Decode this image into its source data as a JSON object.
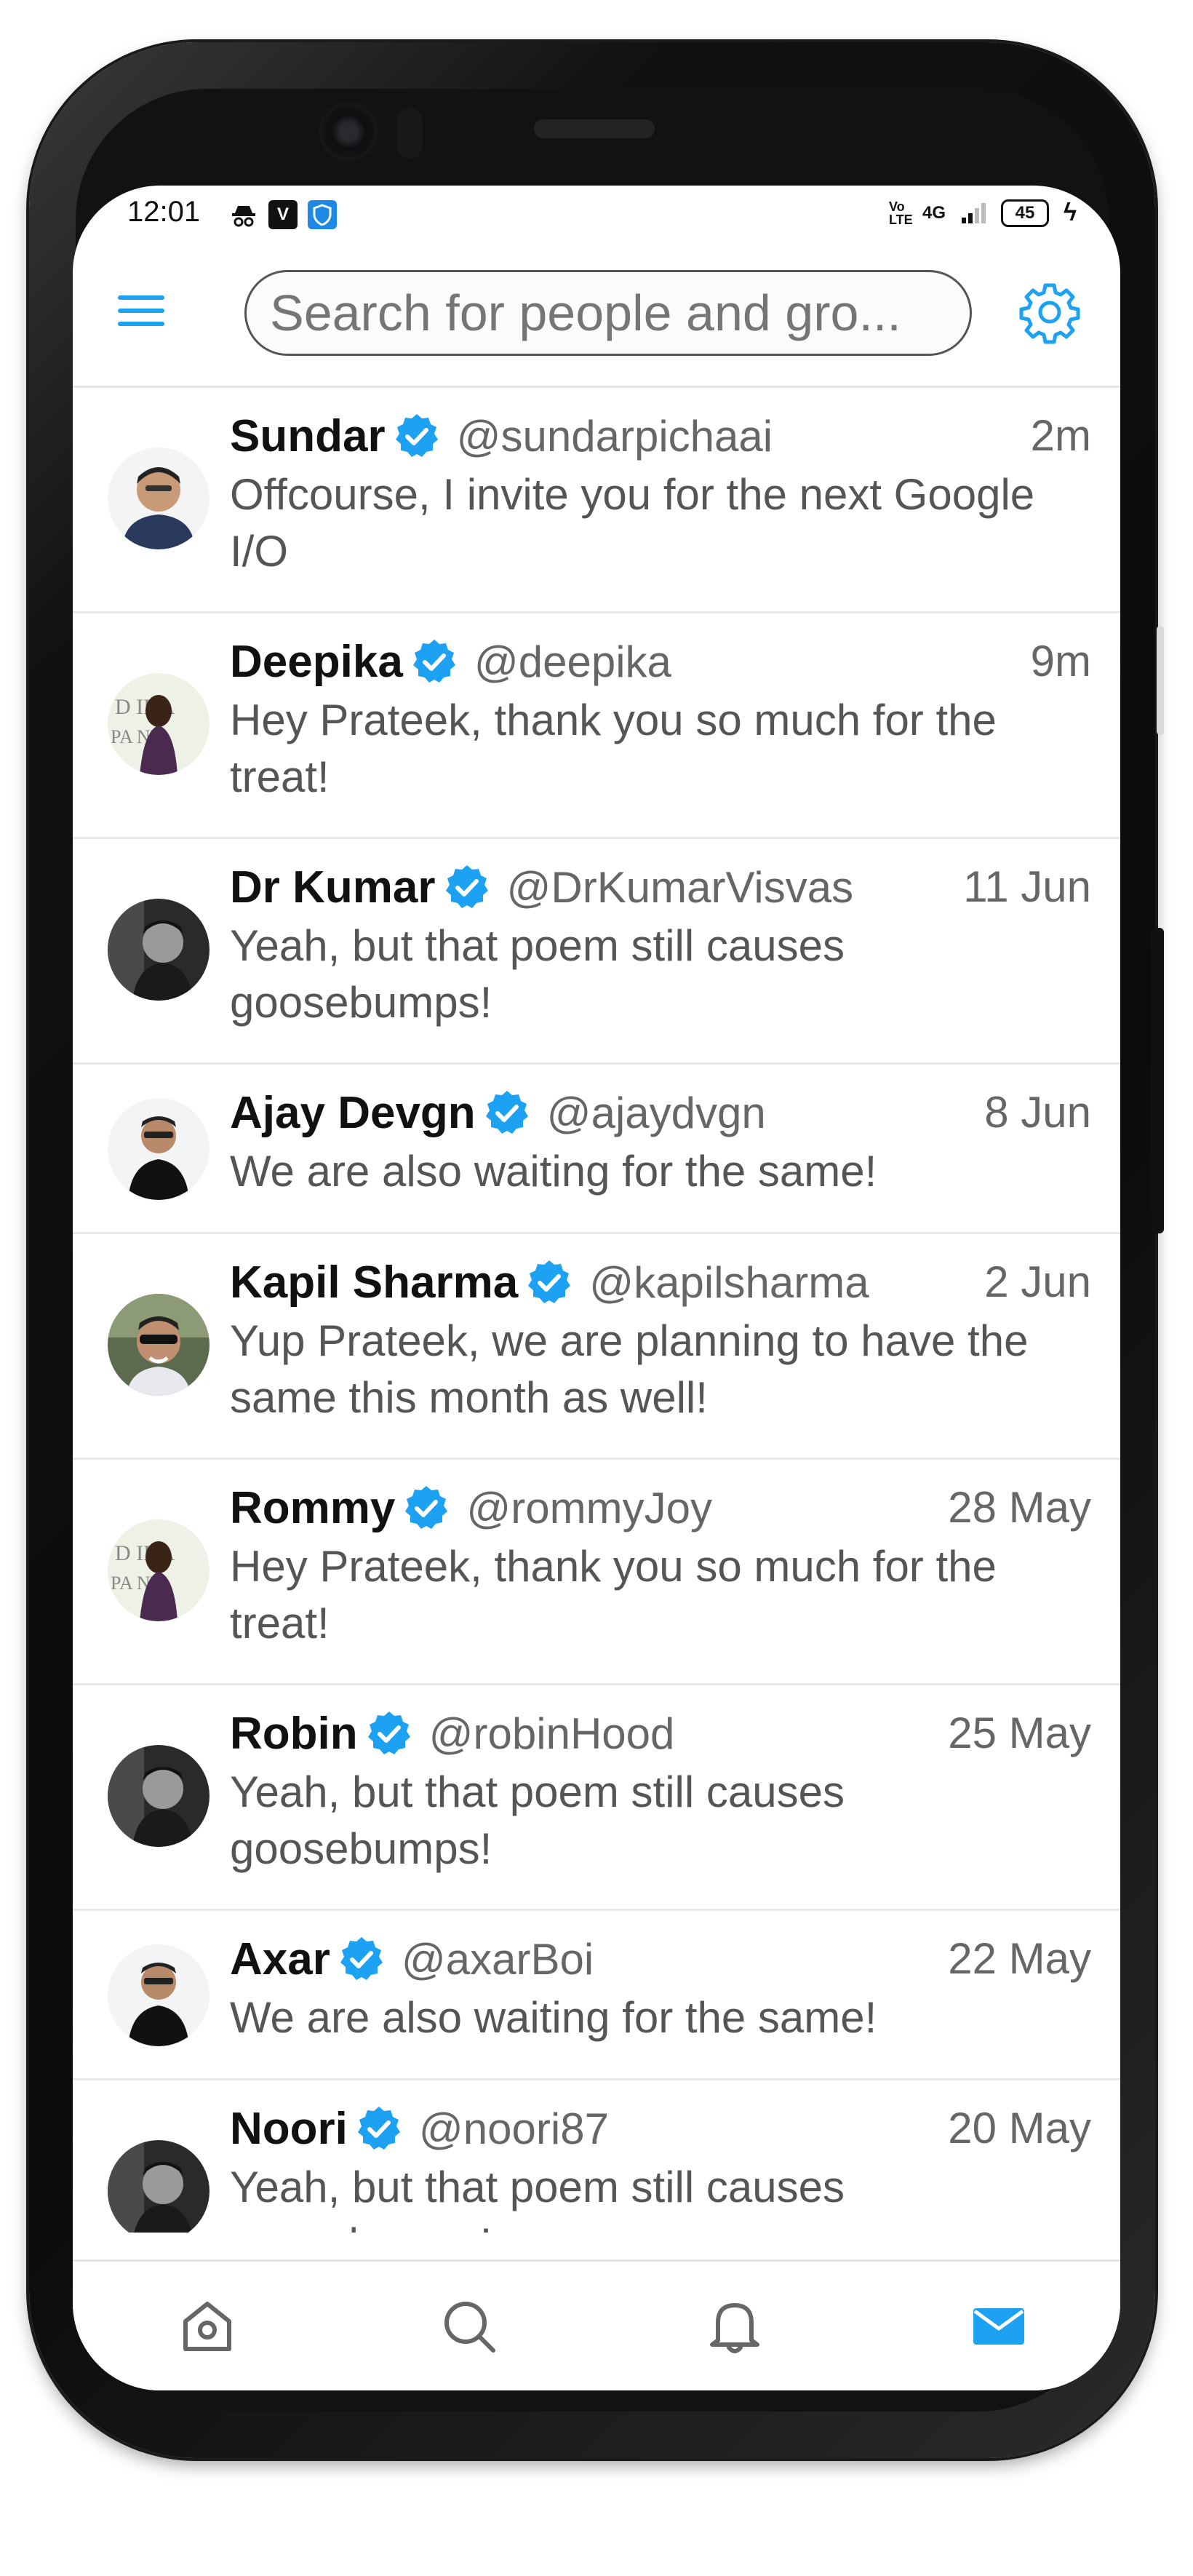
{
  "status_bar": {
    "time": "12:01",
    "left_icons": [
      "incognito-icon",
      "vpn-v-icon",
      "shield-icon"
    ],
    "network_labels": [
      "Vo LTE",
      "4G"
    ],
    "battery": "45"
  },
  "header": {
    "search_placeholder": "Search for people and gro..."
  },
  "feed": [
    {
      "name": "Sundar",
      "handle": "@sundarpichaai",
      "time": "2m",
      "message": "Offcourse, I invite you for the next Google I/O",
      "verified": true
    },
    {
      "name": "Deepika",
      "handle": "@deepika",
      "time": "9m",
      "message": "Hey Prateek, thank you so much for the treat!",
      "verified": true
    },
    {
      "name": "Dr Kumar",
      "handle": "@DrKumarVisvas",
      "time": "11 Jun",
      "message": "Yeah, but that poem still causes goosebumps!",
      "verified": true
    },
    {
      "name": "Ajay Devgn",
      "handle": "@ajaydvgn",
      "time": "8 Jun",
      "message": "We are also waiting for the same!",
      "verified": true
    },
    {
      "name": "Kapil Sharma",
      "handle": "@kapilsharma",
      "time": "2 Jun",
      "message": "Yup Prateek, we are planning to have the same this month as well!",
      "verified": true
    },
    {
      "name": "Rommy",
      "handle": "@rommyJoy",
      "time": "28 May",
      "message": "Hey Prateek, thank you so much for the treat!",
      "verified": true
    },
    {
      "name": "Robin",
      "handle": "@robinHood",
      "time": "25 May",
      "message": "Yeah, but that poem still causes goosebumps!",
      "verified": true
    },
    {
      "name": "Axar",
      "handle": "@axarBoi",
      "time": "22 May",
      "message": "We are also waiting for the same!",
      "verified": true
    },
    {
      "name": "Noori",
      "handle": "@noori87",
      "time": "20 May",
      "message": "Yeah, but that poem still causes goosebumps!",
      "verified": true
    }
  ],
  "bottom_nav": {
    "items": [
      "home-icon",
      "search-icon",
      "bell-icon",
      "mail-icon"
    ],
    "active": "mail-icon"
  },
  "colors": {
    "accent": "#1da1f2",
    "name_text": "#111111",
    "secondary_text": "#666666",
    "divider": "#e8e8e8"
  }
}
